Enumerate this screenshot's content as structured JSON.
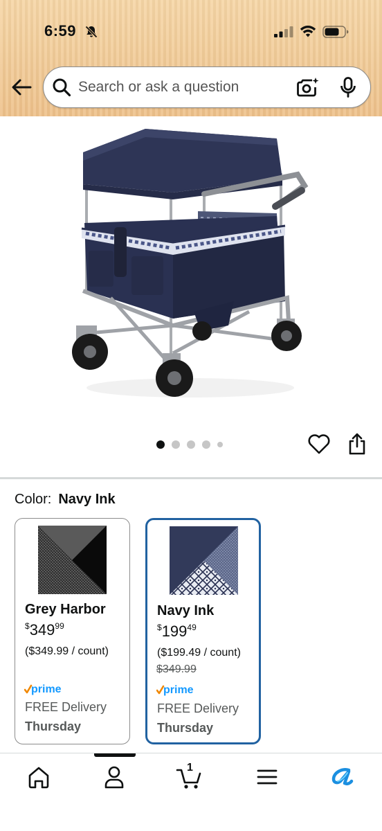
{
  "status_bar": {
    "time": "6:59",
    "icons": [
      "bell-slash-icon",
      "cellular-signal-icon",
      "wifi-icon",
      "battery-icon"
    ]
  },
  "header": {
    "back_icon": "arrow-left-icon",
    "search": {
      "placeholder": "Search or ask a question",
      "value": "",
      "icons": [
        "search-icon",
        "camera-icon",
        "microphone-icon"
      ]
    }
  },
  "product": {
    "image_alt": "",
    "carousel": {
      "total": 5,
      "active_index": 0
    },
    "actions": [
      "heart-icon",
      "share-icon"
    ]
  },
  "color_selector": {
    "label": "Color:",
    "selected": "Navy Ink",
    "options": [
      {
        "name": "Grey Harbor",
        "price_symbol": "$",
        "price_whole": "349",
        "price_fraction": "99",
        "unit_price": "($349.99 / count)",
        "list_price": "",
        "badge": "prime",
        "delivery": "FREE Delivery",
        "day": "Thursday"
      },
      {
        "name": "Navy Ink",
        "price_symbol": "$",
        "price_whole": "199",
        "price_fraction": "49",
        "unit_price": "($199.49 / count)",
        "list_price": "$349.99",
        "badge": "prime",
        "delivery": "FREE Delivery",
        "day": "Thursday"
      }
    ]
  },
  "bottom_nav": {
    "items": [
      "home-icon",
      "account-icon",
      "cart-icon",
      "menu-icon",
      "rufus-icon"
    ],
    "cart_count": "1"
  },
  "colors": {
    "header_bg": "#eec18a",
    "selected_border": "#2162a1",
    "prime_blue": "#1399ff",
    "prime_check": "#f08804"
  }
}
